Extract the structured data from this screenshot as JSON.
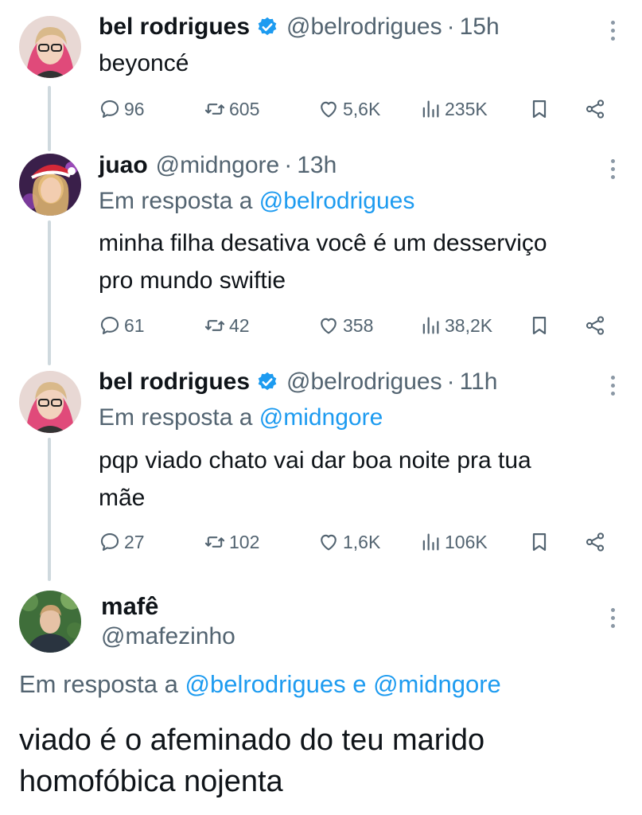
{
  "tweets": [
    {
      "name": "bel rodrigues",
      "handle": "@belrodrigues",
      "sep": "·",
      "time": "15h",
      "text": "beyoncé",
      "stats": {
        "replies": "96",
        "retweets": "605",
        "likes": "5,6K",
        "views": "235K"
      }
    },
    {
      "name": "juao",
      "handle": "@midngore",
      "sep": "·",
      "time": "13h",
      "reply_prefix": "Em resposta a",
      "reply_mention": "@belrodrigues",
      "text_line1": "minha filha desativa você é um desserviço",
      "text_line2": "pro mundo swiftie",
      "stats": {
        "replies": "61",
        "retweets": "42",
        "likes": "358",
        "views": "38,2K"
      }
    },
    {
      "name": "bel rodrigues",
      "handle": "@belrodrigues",
      "sep": "·",
      "time": "11h",
      "reply_prefix": "Em resposta a",
      "reply_mention": "@midngore",
      "text_line1": "pqp viado chato vai dar boa noite pra tua",
      "text_line2": "mãe",
      "stats": {
        "replies": "27",
        "retweets": "102",
        "likes": "1,6K",
        "views": "106K"
      }
    }
  ],
  "focus_tweet": {
    "name": "mafê",
    "handle": "@mafezinho",
    "reply_prefix": "Em resposta a",
    "reply_mention_1": "@belrodrigues",
    "reply_joiner": "e",
    "reply_mention_2": "@midngore",
    "text_line1": "viado é o afeminado do teu marido",
    "text_line2": "homofóbica nojenta"
  },
  "colors": {
    "accent": "#1d9bf0",
    "muted": "#536471",
    "text": "#0f1419",
    "thread_line": "#cfd9de"
  },
  "icons": [
    "verified-badge-icon",
    "more-icon",
    "reply-icon",
    "retweet-icon",
    "like-icon",
    "views-icon",
    "bookmark-icon",
    "share-icon"
  ]
}
